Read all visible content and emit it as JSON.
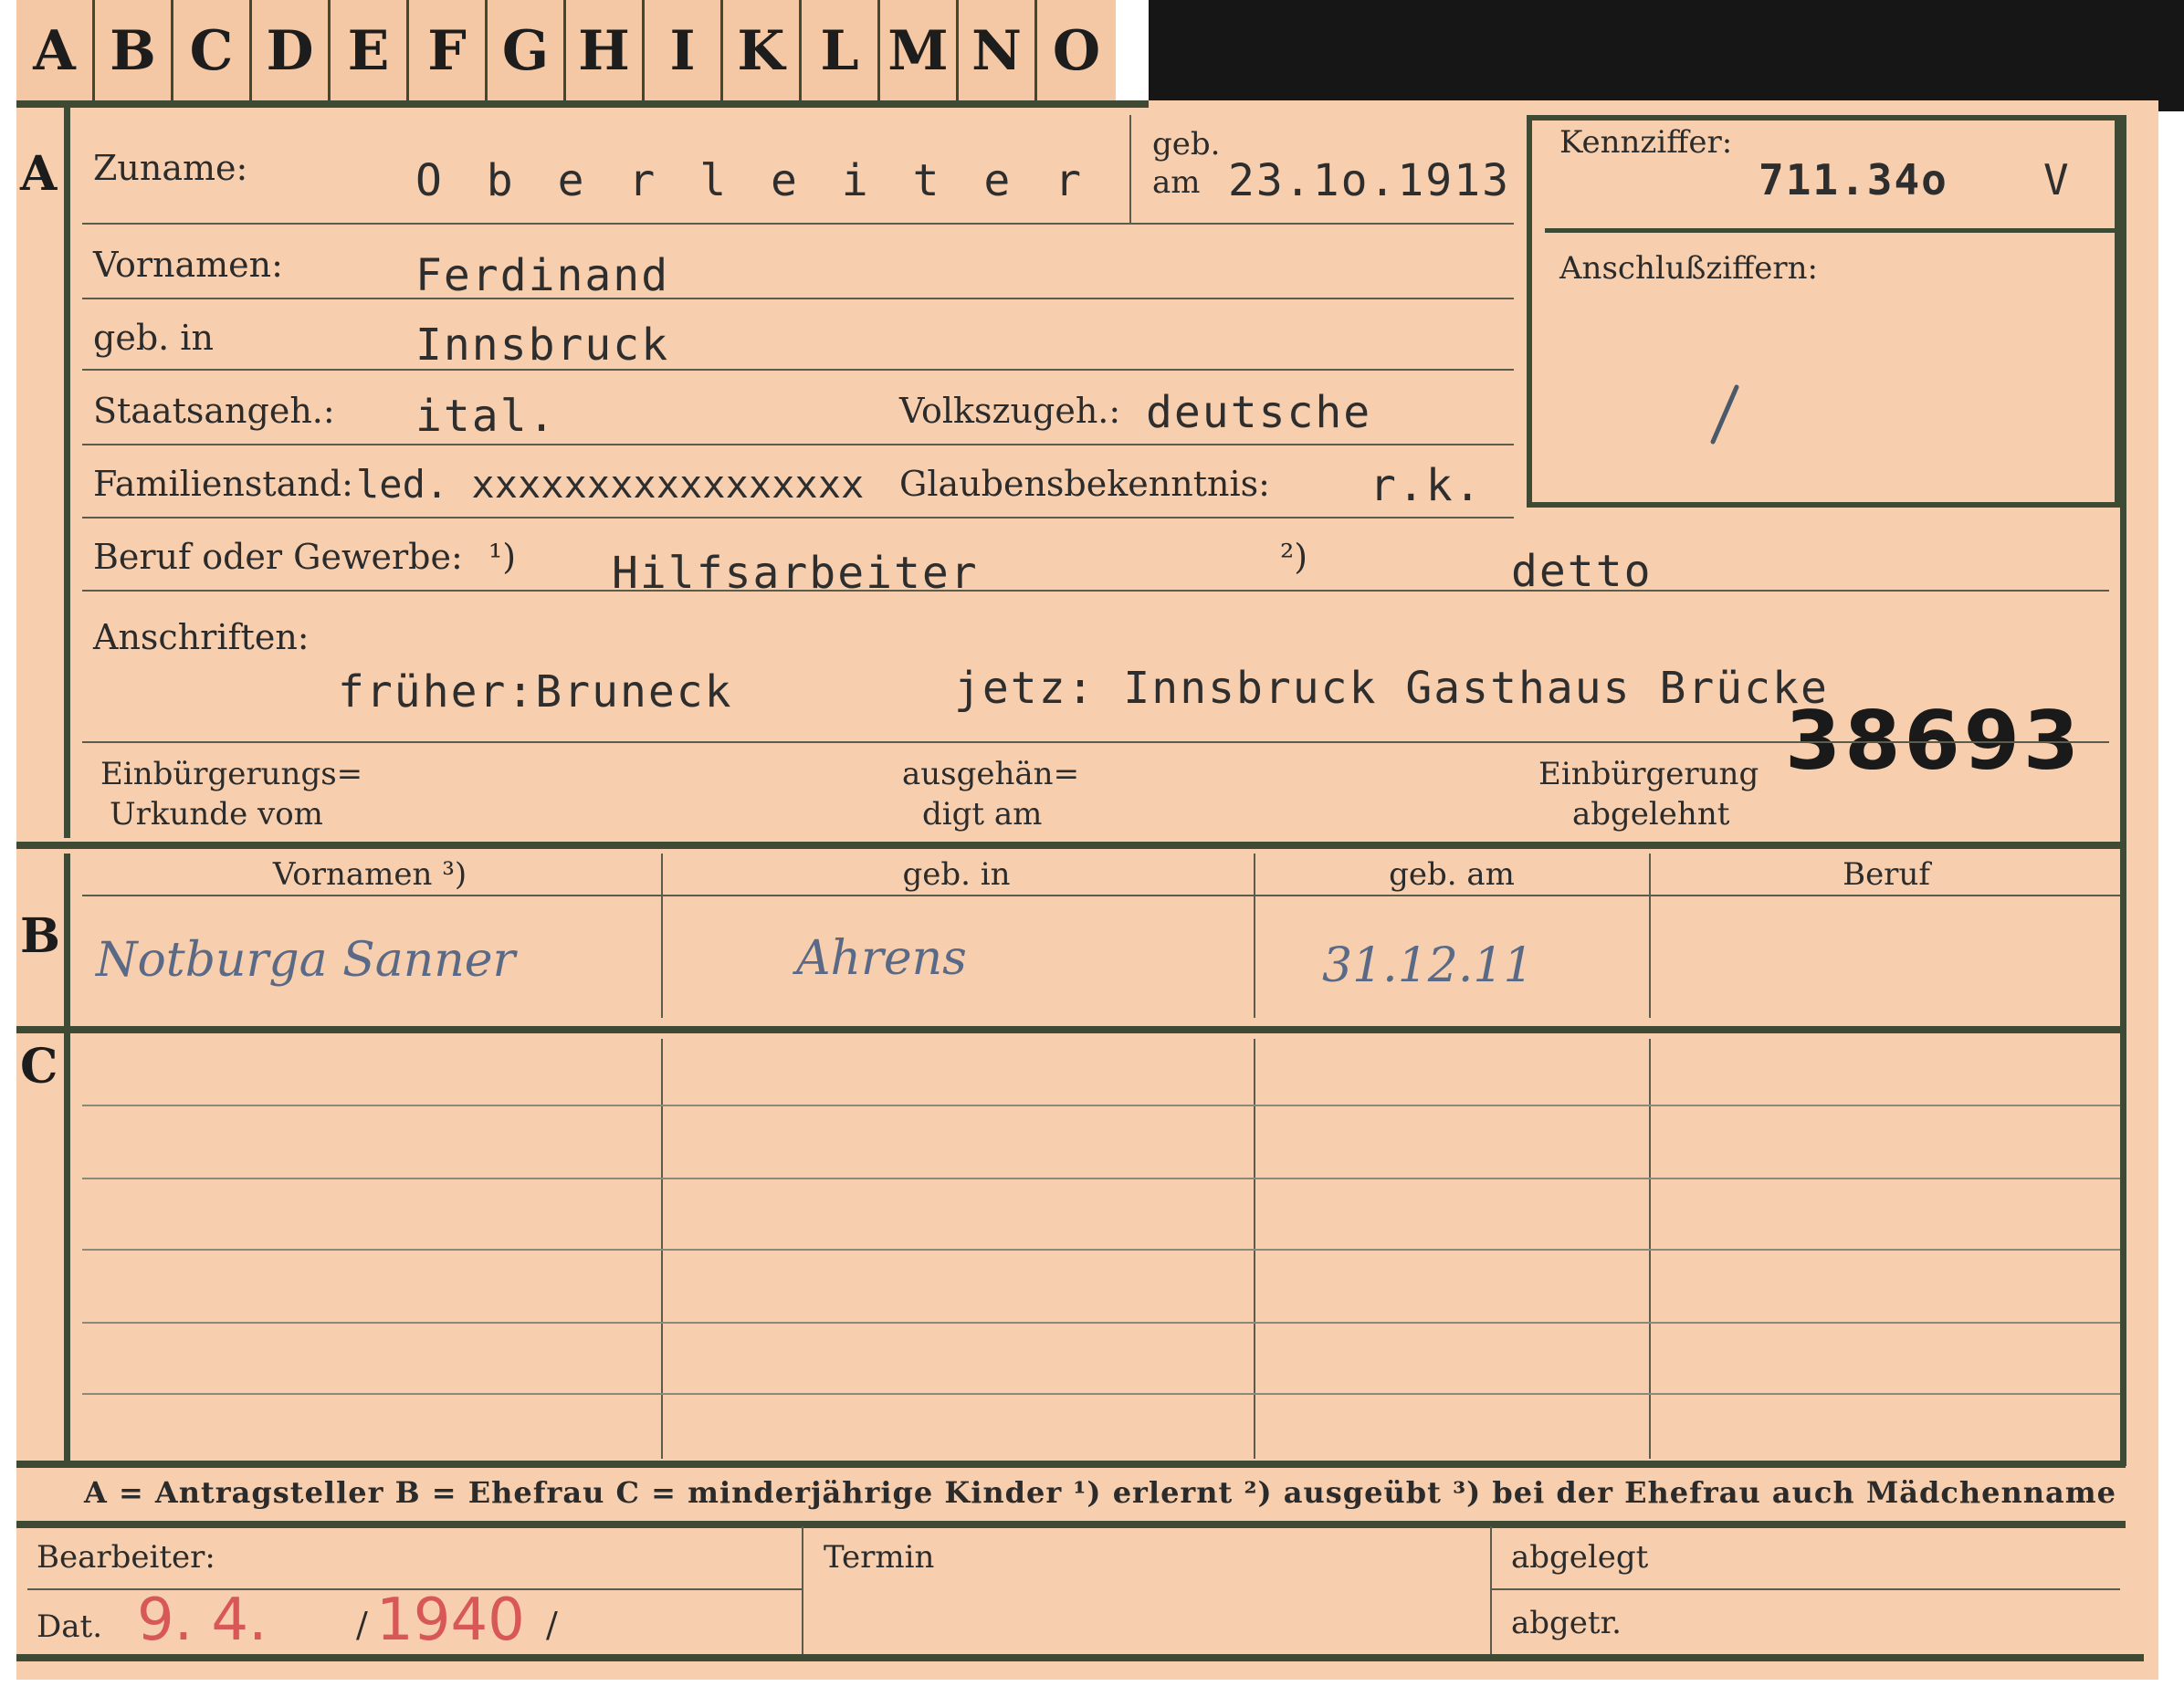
{
  "tabs": [
    "A",
    "B",
    "C",
    "D",
    "E",
    "F",
    "G",
    "H",
    "I",
    "K",
    "L",
    "M",
    "N",
    "O"
  ],
  "section_a": {
    "marker": "A",
    "zuname_label": "Zuname:",
    "zuname_value": "O b e r l e i t e r",
    "geb_label": "geb.",
    "am_label": "am",
    "geb_am_value": "23.1o.1913",
    "kennziffer_label": "Kennziffer:",
    "kennziffer_value": "711.34o",
    "kennziffer_suffix": "V",
    "anschluss_label": "Anschlußziffern:",
    "vornamen_label": "Vornamen:",
    "vornamen_value": "Ferdinand",
    "geb_in_label": "geb. in",
    "geb_in_value": "Innsbruck",
    "staatsangeh_label": "Staatsangeh.:",
    "staatsangeh_value": "ital.",
    "volkszugeh_label": "Volkszugeh.:",
    "volkszugeh_value": "deutsche",
    "familienstand_label": "Familienstand:",
    "familienstand_value": "led. xxxxxxxxxxxxxxxxx",
    "glaubens_label": "Glaubensbekenntnis:",
    "glaubens_value": "r.k.",
    "beruf_label": "Beruf oder Gewerbe:",
    "beruf_note1": "¹)",
    "beruf_value1": "Hilfsarbeiter",
    "beruf_note2": "²)",
    "beruf_value2": "detto",
    "anschriften_label": "Anschriften:",
    "anschrift_frueher": "früher:Bruneck",
    "anschrift_jetzt": "jetz: Innsbruck Gasthaus Brücke",
    "stamp_number": "38693",
    "einbuergerung_urkunde_line1": "Einbürgerungs=",
    "einbuergerung_urkunde_line2": "Urkunde vom",
    "ausgehaendigt_line1": "ausgehän=",
    "ausgehaendigt_line2": "digt am",
    "abgelehnt_line1": "Einbürgerung",
    "abgelehnt_line2": "abgelehnt"
  },
  "section_b": {
    "marker": "B",
    "headers": [
      "Vornamen ³)",
      "geb. in",
      "geb. am",
      "Beruf"
    ],
    "row": [
      "Notburga Sanner",
      "Ahrens",
      "31.12.11",
      ""
    ]
  },
  "section_c": {
    "marker": "C"
  },
  "legend": "A = Antragsteller   B = Ehefrau   C = minderjährige Kinder   ¹) erlernt   ²) ausgeübt   ³) bei der Ehefrau auch Mädchenname",
  "footer": {
    "bearbeiter_label": "Bearbeiter:",
    "dat_label": "Dat.",
    "dat_day": "9. 4.",
    "dat_sep1": "/",
    "dat_year": "1940",
    "dat_sep2": "/",
    "termin_label": "Termin",
    "abgelegt_label": "abgelegt",
    "abgetr_label": "abgetr."
  },
  "colors": {
    "card": "#f7cfae",
    "rule": "#3f4a34",
    "ink_handwriting": "#5a6a86",
    "ink_red": "#d85858"
  }
}
